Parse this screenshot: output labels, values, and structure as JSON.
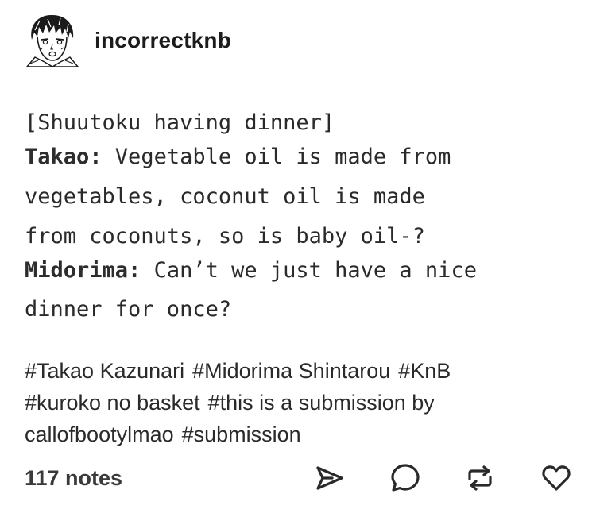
{
  "post": {
    "blog_name": "incorrectknb",
    "avatar_icon": "manga-character-avatar",
    "lines": [
      {
        "speaker": "",
        "text": "[Shuutoku having dinner]"
      },
      {
        "speaker": "Takao:",
        "text": " Vegetable oil is made from"
      },
      {
        "speaker": "",
        "text": "vegetables, coconut oil is made"
      },
      {
        "speaker": "",
        "text": "from coconuts, so is baby oil-?"
      },
      {
        "speaker": "Midorima:",
        "text": " Can’t we just have a nice"
      },
      {
        "speaker": "",
        "text": "dinner for once?"
      }
    ],
    "tag_lines": [
      [
        "#Takao Kazunari",
        "#Midorima Shintarou",
        "#KnB"
      ],
      [
        "#kuroko no basket",
        "#this is a submission by"
      ],
      [
        "callofbootylmao",
        "#submission"
      ]
    ]
  },
  "footer": {
    "notes": "117 notes",
    "icons": [
      "share-icon",
      "reply-icon",
      "reblog-icon",
      "like-icon"
    ]
  }
}
